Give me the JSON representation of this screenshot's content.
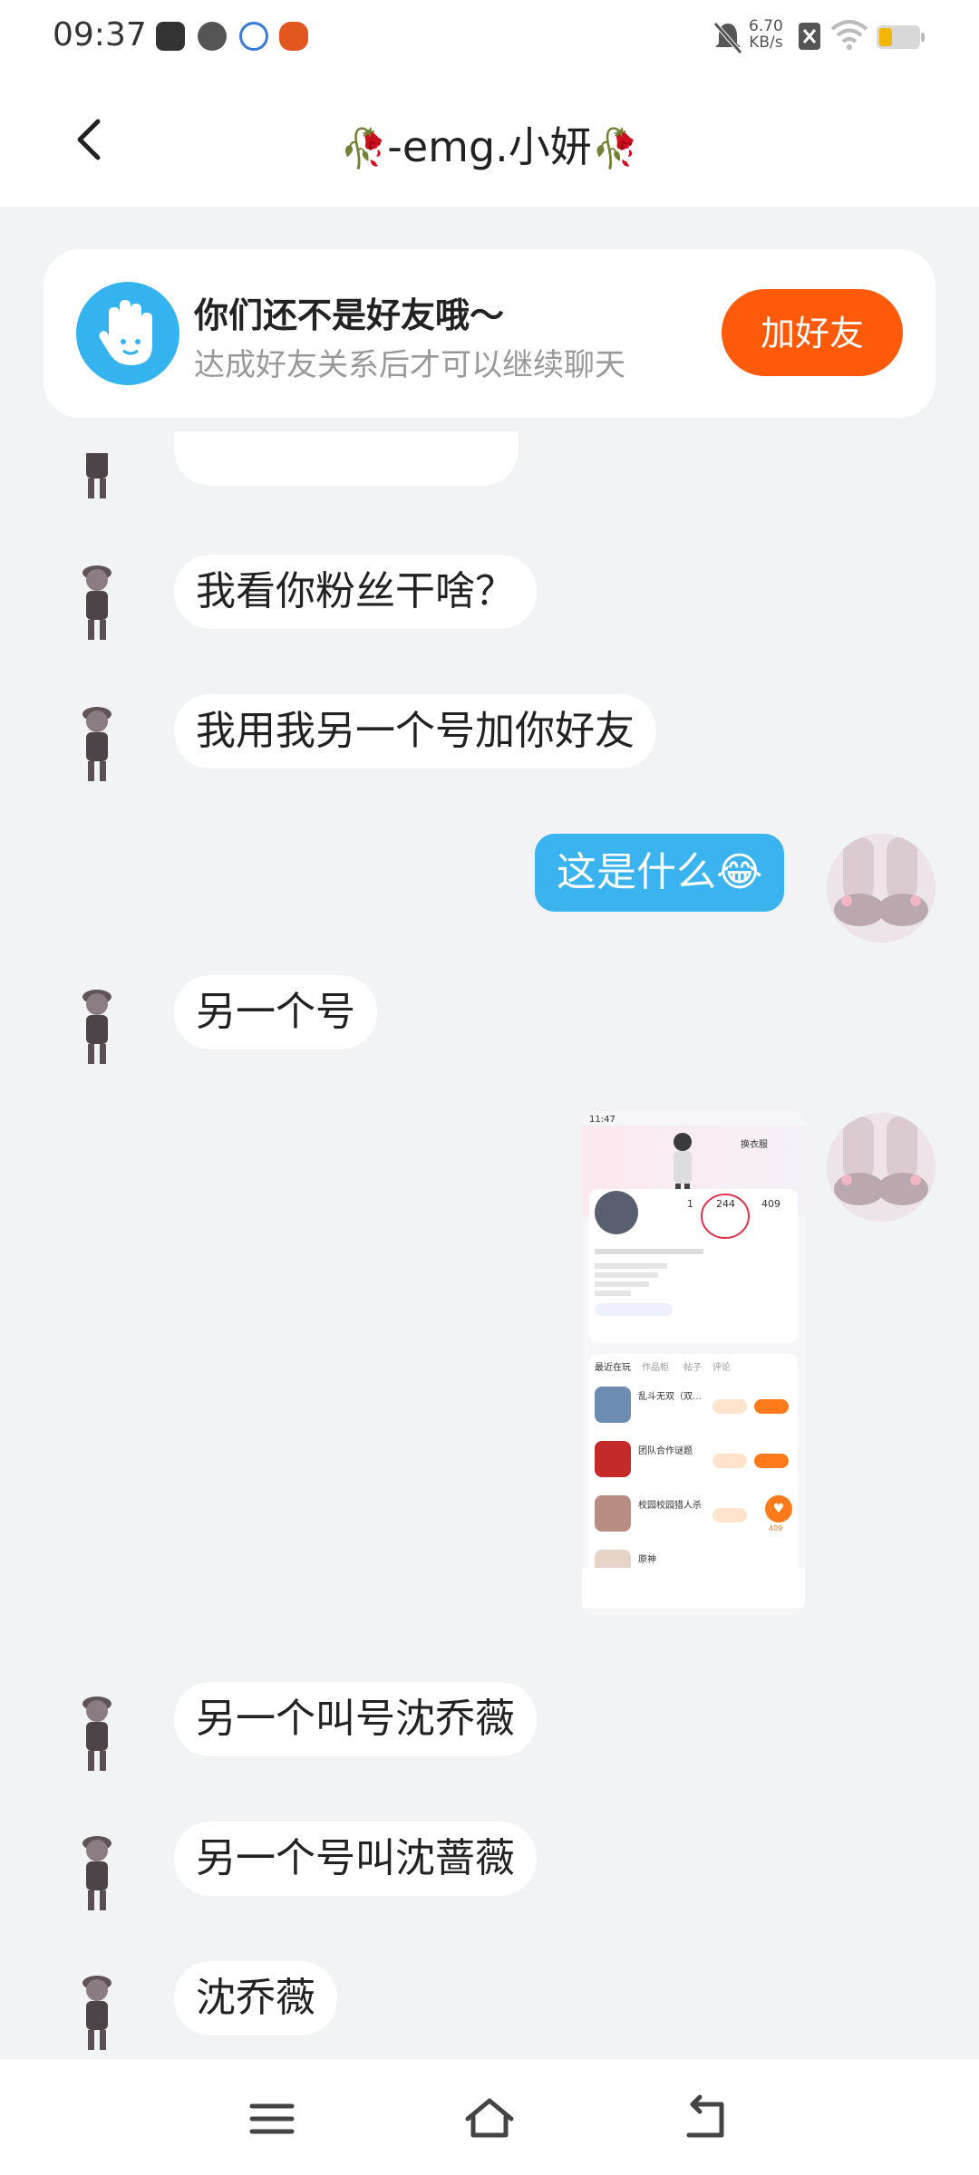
{
  "status": {
    "time": "09:37",
    "net_speed_value": "6.70",
    "net_speed_unit": "KB/s",
    "battery_color": "#f2b705",
    "icons": [
      "app-icon",
      "speedometer-icon",
      "ifly-icon",
      "pumpkin-icon",
      "mute-icon",
      "sim-off-icon",
      "wifi-icon",
      "battery-icon"
    ]
  },
  "header": {
    "rose_left": "🥀",
    "title": "-emg.小妍",
    "rose_right": "🥀",
    "back_icon": "back-chevron-icon"
  },
  "banner": {
    "title": "你们还不是好友哦～",
    "subtitle": "达成好友关系后才可以继续聊天",
    "button": "加好友",
    "accent": "#ff5a0a",
    "icon": "wave-hand-icon"
  },
  "messages": [
    {
      "side": "left",
      "text": "我看你粉丝干啥？"
    },
    {
      "side": "left",
      "text": "我用我另一个号加你好友"
    },
    {
      "side": "right",
      "text": "这是什么",
      "emoji": "😂"
    },
    {
      "side": "left",
      "text": "另一个号"
    },
    {
      "side": "right",
      "type": "image"
    },
    {
      "side": "left",
      "text": "另一个叫号沈乔薇"
    },
    {
      "side": "left",
      "text": "另一个号叫沈蔷薇"
    },
    {
      "side": "left",
      "text": "沈乔薇"
    }
  ],
  "shared_screenshot": {
    "time": "11:47",
    "dress_label": "换衣服",
    "stat1": "1",
    "stat2": "244",
    "stat3": "409",
    "tabs": [
      "最近在玩",
      "作品柜",
      "帖子",
      "评论"
    ],
    "games": [
      "乱斗无双（双…",
      "团队合作谜题",
      "校园校园猎人杀",
      "原神"
    ],
    "like_count": "409"
  },
  "navbar": {
    "icons": [
      "menu-icon",
      "home-icon",
      "back-icon"
    ]
  }
}
